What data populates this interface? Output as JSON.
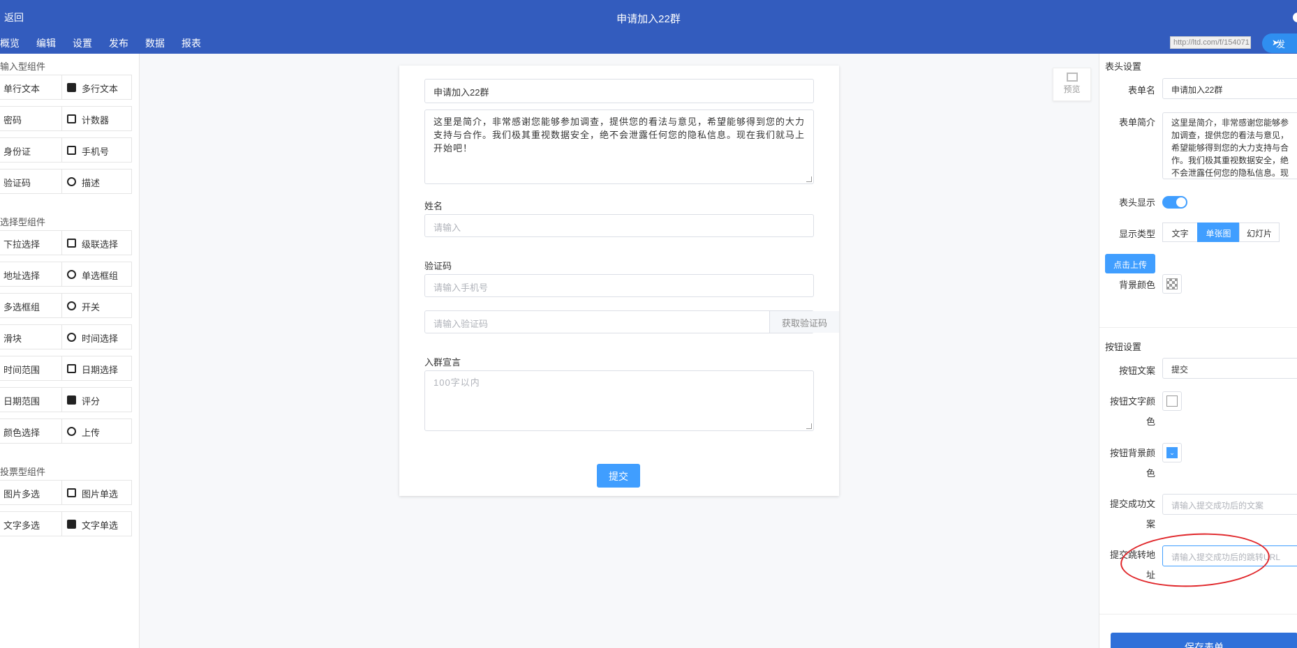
{
  "header": {
    "back_label": "返回",
    "title": "申请加入22群",
    "menu": [
      "概览",
      "编辑",
      "设置",
      "发布",
      "数据",
      "报表"
    ],
    "url": "http://ltd.com/f/154071",
    "publish_label": "发"
  },
  "components": {
    "input_group_title": "输入型组件",
    "input_items": [
      "单行文本",
      "多行文本",
      "密码",
      "计数器",
      "身份证",
      "手机号",
      "验证码",
      "描述"
    ],
    "select_group_title": "选择型组件",
    "select_items": [
      "下拉选择",
      "级联选择",
      "地址选择",
      "单选框组",
      "多选框组",
      "开关",
      "滑块",
      "时间选择",
      "时间范围",
      "日期选择",
      "日期范围",
      "评分",
      "颜色选择",
      "上传"
    ],
    "vote_group_title": "投票型组件",
    "vote_items": [
      "图片多选",
      "图片单选",
      "文字多选",
      "文字单选"
    ]
  },
  "form": {
    "title_value": "申请加入22群",
    "intro_value": "这里是简介，非常感谢您能够参加调查，提供您的看法与意见，希望能够得到您的大力支持与合作。我们极其重视数据安全，绝不会泄露任何您的隐私信息。现在我们就马上开始吧！",
    "name_label": "姓名",
    "name_placeholder": "请输入",
    "code_label": "验证码",
    "phone_placeholder": "请输入手机号",
    "code_placeholder": "请输入验证码",
    "get_code_label": "获取验证码",
    "declaration_label": "入群宣言",
    "declaration_placeholder": "100字以内",
    "submit_label": "提交"
  },
  "preview_label": "预览",
  "settings": {
    "header_section": "表头设置",
    "form_name_label": "表单名",
    "form_name_value": "申请加入22群",
    "form_intro_label": "表单简介",
    "form_intro_value": "这里是简介，非常感谢您能够参加调查，提供您的看法与意见，希望能够得到您的大力支持与合作。我们极其重视数据安全，绝不会泄露任何您的隐私信息。现在我们就马上开始吧！",
    "header_display_label": "表头显示",
    "header_display_on": true,
    "display_type_label": "显示类型",
    "display_types": [
      "文字",
      "单张图",
      "幻灯片"
    ],
    "display_type_selected": "单张图",
    "upload_label": "点击上传",
    "bg_color_label": "背景颜色",
    "button_section": "按钮设置",
    "button_text_label": "按钮文案",
    "button_text_value": "提交",
    "button_text_color_label": "按钮文字颜色",
    "button_bg_color_label": "按钮背景颜色",
    "button_bg_color": "#409eff",
    "success_text_label": "提交成功文案",
    "success_text_placeholder": "请输入提交成功后的文案",
    "redirect_label": "提交跳转地址",
    "redirect_placeholder": "请输入提交成功后的跳转URL",
    "save_label": "保存表单"
  },
  "colors": {
    "header_bg": "#335cbe",
    "primary": "#409eff",
    "annotation": "#e0262a"
  }
}
